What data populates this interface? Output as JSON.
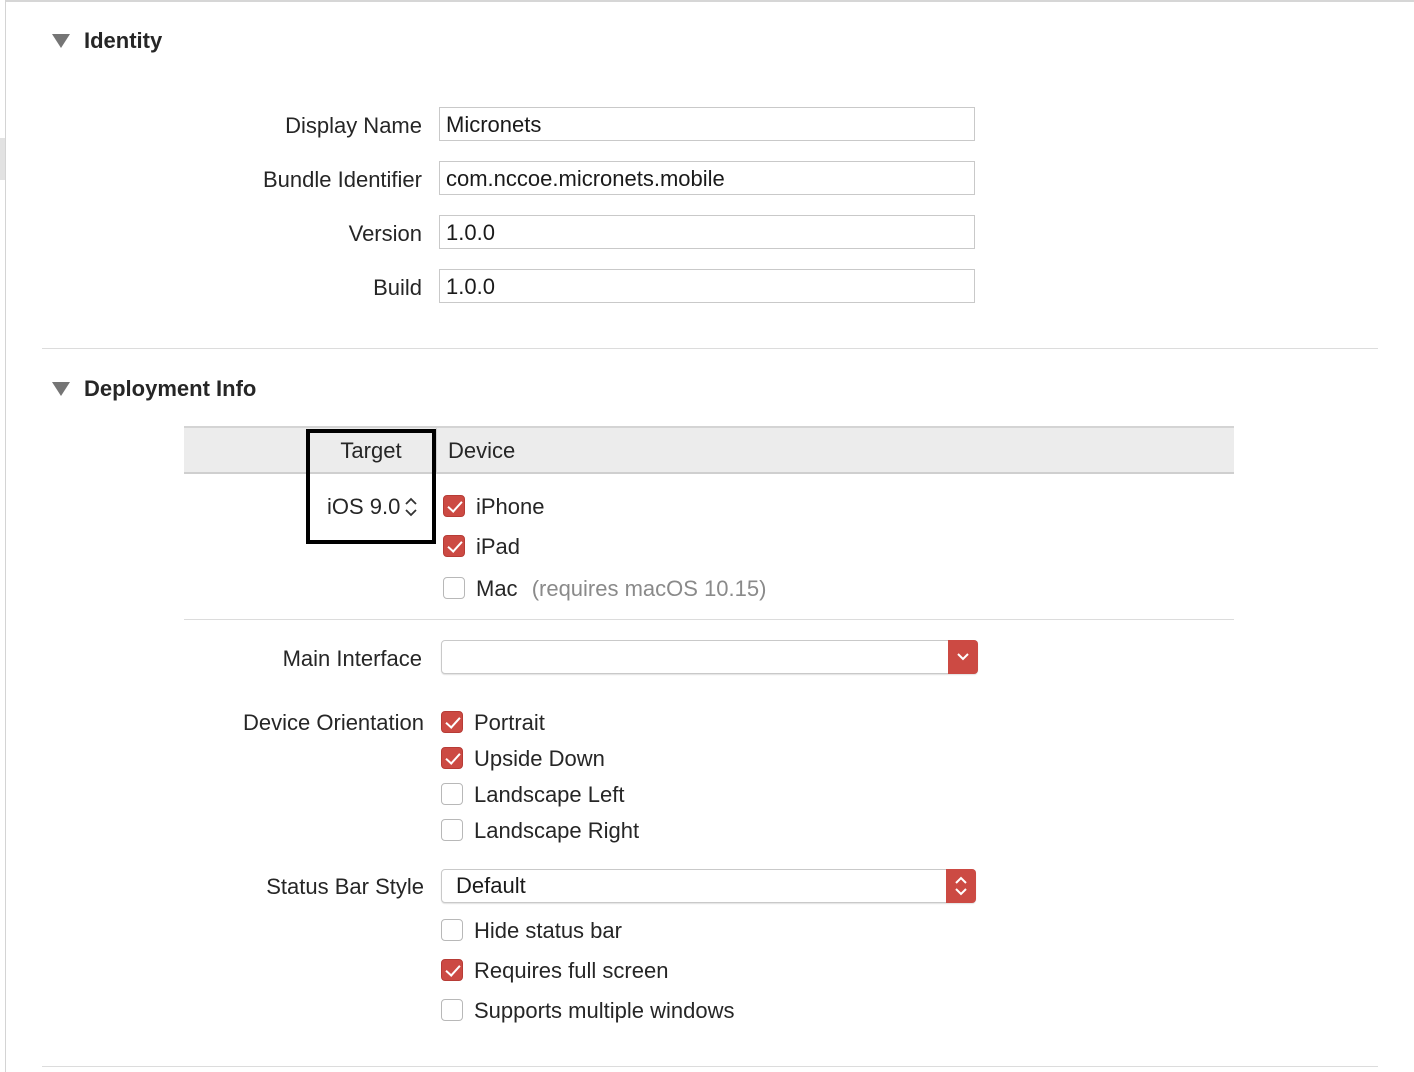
{
  "identity": {
    "title": "Identity",
    "fields": [
      {
        "label": "Display Name",
        "value": "Micronets"
      },
      {
        "label": "Bundle Identifier",
        "value": "com.nccoe.micronets.mobile"
      },
      {
        "label": "Version",
        "value": "1.0.0"
      },
      {
        "label": "Build",
        "value": "1.0.0"
      }
    ]
  },
  "deployment": {
    "title": "Deployment Info",
    "table": {
      "target_header": "Target",
      "device_header": "Device",
      "target_value": "iOS 9.0",
      "devices": [
        {
          "label": "iPhone",
          "checked": true
        },
        {
          "label": "iPad",
          "checked": true
        },
        {
          "label": "Mac",
          "checked": false,
          "note": "(requires macOS 10.15)"
        }
      ]
    },
    "main_interface": {
      "label": "Main Interface",
      "value": ""
    },
    "device_orientation": {
      "label": "Device Orientation",
      "options": [
        {
          "label": "Portrait",
          "checked": true
        },
        {
          "label": "Upside Down",
          "checked": true
        },
        {
          "label": "Landscape Left",
          "checked": false
        },
        {
          "label": "Landscape Right",
          "checked": false
        }
      ]
    },
    "status_bar": {
      "label": "Status Bar Style",
      "value": "Default",
      "options": [
        {
          "label": "Hide status bar",
          "checked": false
        },
        {
          "label": "Requires full screen",
          "checked": true
        },
        {
          "label": "Supports multiple windows",
          "checked": false
        }
      ]
    }
  },
  "colors": {
    "accent": "#cc4a43",
    "disclosure": "#757575"
  }
}
